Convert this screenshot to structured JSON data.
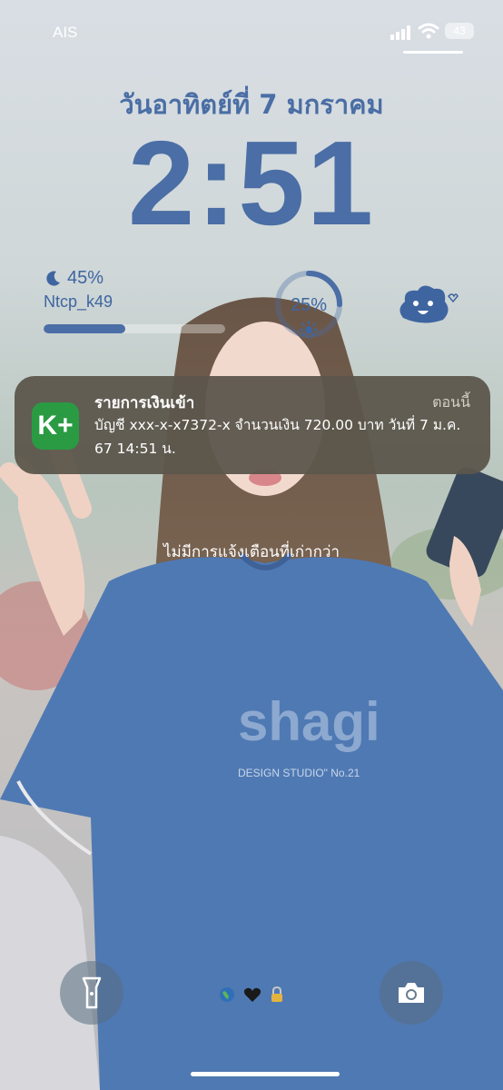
{
  "status_bar": {
    "carrier": "AIS",
    "battery_level": "43",
    "icons": [
      "signal-bars-icon",
      "wifi-icon",
      "battery-icon"
    ]
  },
  "lock_screen": {
    "date": "วันอาทิตย์ที่ 7 มกราคม",
    "time": "2:51"
  },
  "widgets": {
    "battery": {
      "icon": "moon-icon",
      "percent": "45%",
      "percent_value": 45,
      "device_name": "Ntcp_k49"
    },
    "ring": {
      "label": "25%",
      "value": 25,
      "icon": "sun-icon"
    },
    "character_icon": "cloud-character-icon"
  },
  "notification": {
    "app_icon_label": "K+",
    "app_icon_color": "#2a9b43",
    "title": "รายการเงินเข้า",
    "time": "ตอนนี้",
    "body": "บัญชี xxx-x-x7372-x  จำนวนเงิน 720.00 บาท  วันที่ 7 ม.ค. 67  14:51 น."
  },
  "no_older_notifications": "ไม่มีการแจ้งเตือนที่เก่ากว่า",
  "bottom_bar": {
    "left_button": "flashlight-icon",
    "right_button": "camera-icon",
    "indicators": [
      "globe-icon",
      "black-heart-icon",
      "lock-icon"
    ]
  },
  "colors": {
    "accent": "#4a6ea5",
    "notification_bg": "#5c564c"
  }
}
